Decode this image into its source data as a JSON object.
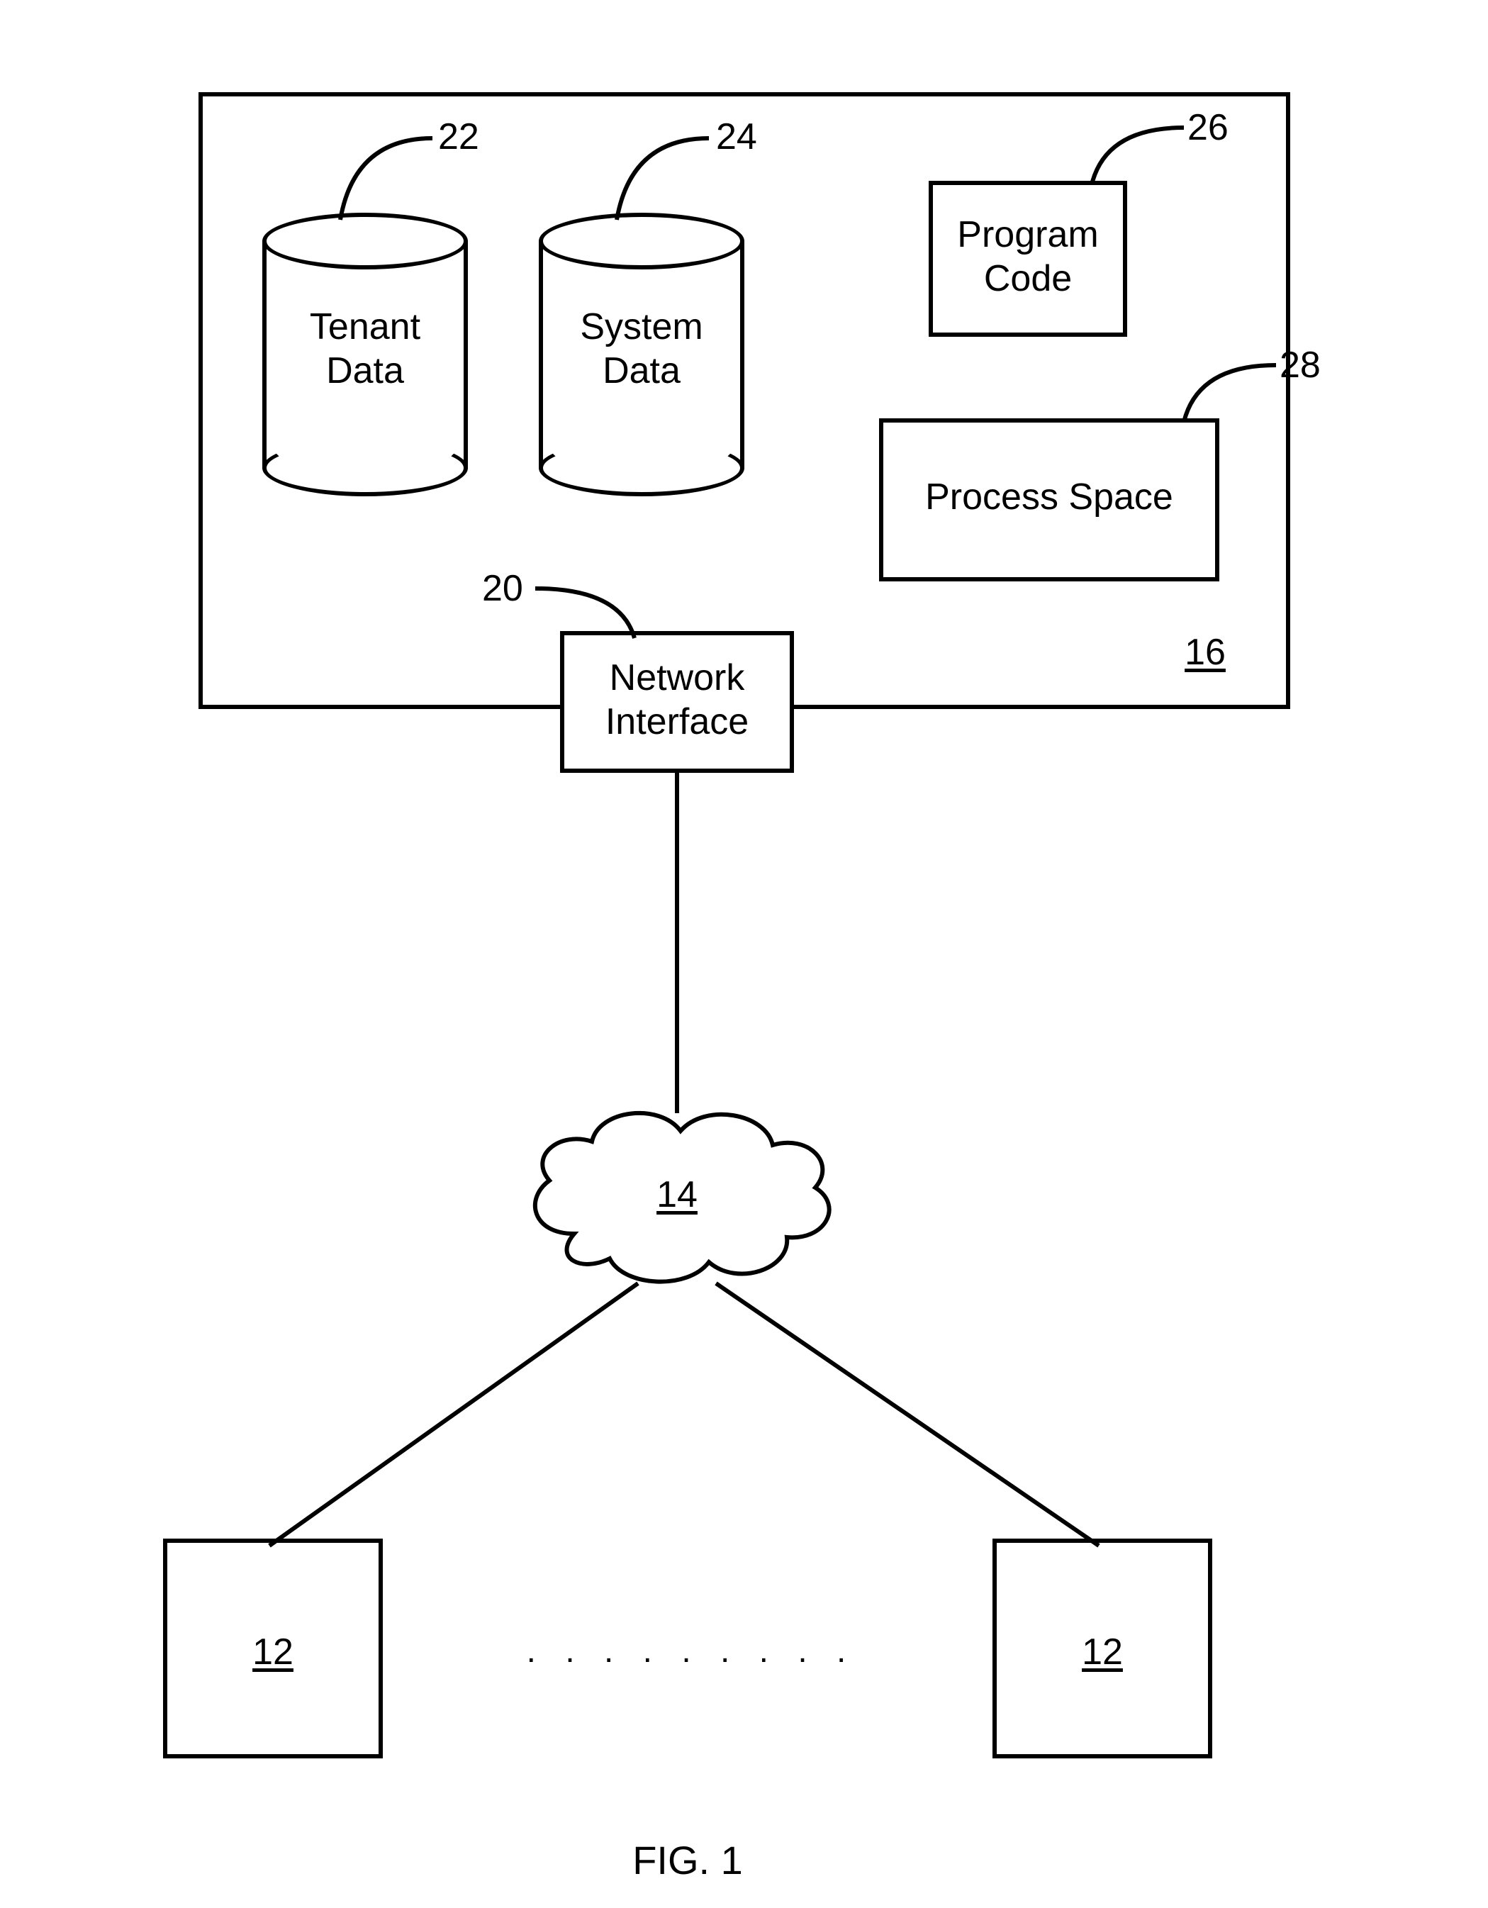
{
  "figure_caption": "FIG. 1",
  "main_box": {
    "ref": "16"
  },
  "tenant_cyl": {
    "label": "Tenant\nData",
    "ref": "22"
  },
  "system_cyl": {
    "label": "System\nData",
    "ref": "24"
  },
  "program_code": {
    "label": "Program\nCode",
    "ref": "26"
  },
  "process_space": {
    "label": "Process Space",
    "ref": "28"
  },
  "network_interface": {
    "label": "Network\nInterface",
    "ref": "20"
  },
  "cloud": {
    "ref": "14"
  },
  "client_left": {
    "ref": "12"
  },
  "client_right": {
    "ref": "12"
  },
  "dots": ". . . . . . . . ."
}
